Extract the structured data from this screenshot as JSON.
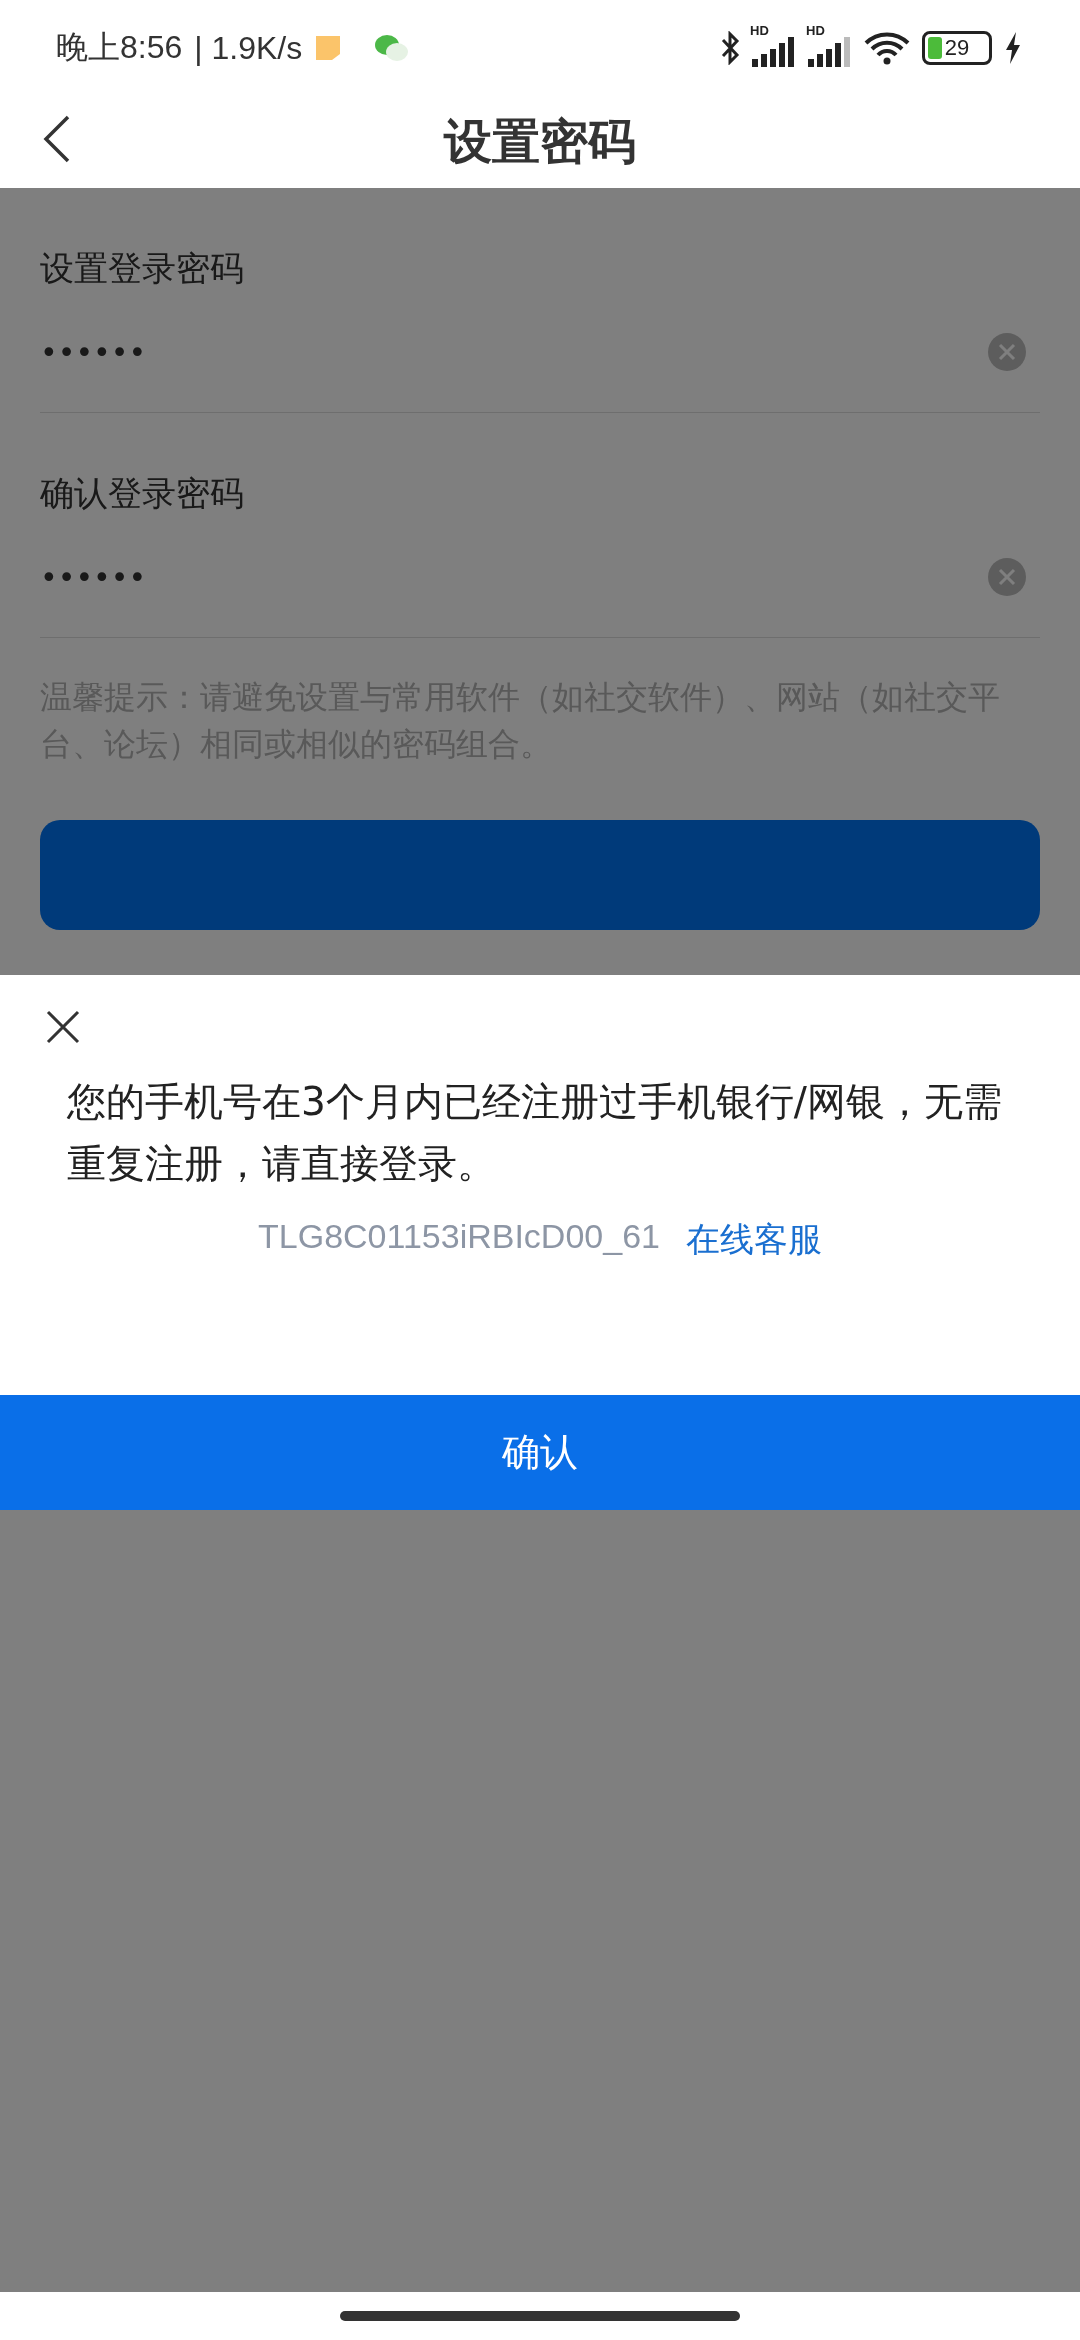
{
  "status_bar": {
    "time": "晚上8:56",
    "speed": "| 1.9K/s",
    "network_labels": [
      "HD",
      "HD"
    ],
    "battery": "29"
  },
  "nav": {
    "title": "设置密码"
  },
  "form": {
    "fields": [
      {
        "label": "设置登录密码",
        "value": "••••••"
      },
      {
        "label": "确认登录密码",
        "value": "••••••"
      }
    ],
    "hint": "温馨提示：请避免设置与常用软件（如社交软件）、网站（如社交平台、论坛）相同或相似的密码组合。"
  },
  "dialog": {
    "message": "您的手机号在3个月内已经注册过手机银行/网银，无需重复注册，请直接登录。",
    "code": "TLG8C01153iRBIcD00_61",
    "link": "在线客服",
    "confirm": "确认"
  }
}
